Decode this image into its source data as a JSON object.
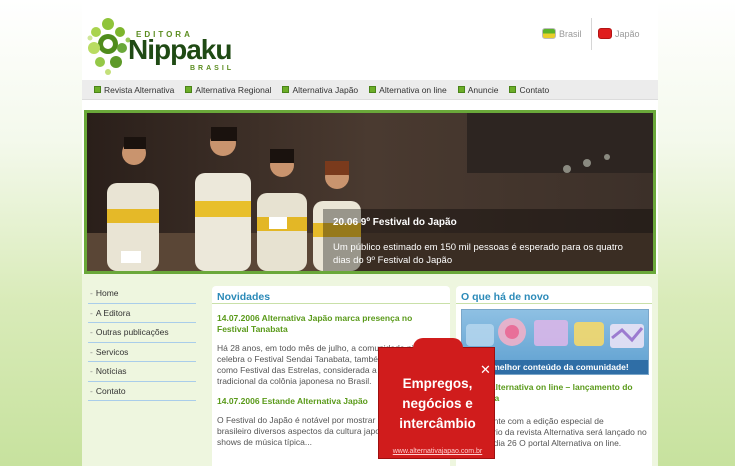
{
  "header": {
    "logo_small_top": "EDITORA",
    "logo_name": "Nippaku",
    "logo_small_bottom": "BRASIL",
    "languages": [
      {
        "label": "Brasil",
        "icon": "brazil-flag-icon"
      },
      {
        "label": "Japão",
        "icon": "japan-flag-icon"
      }
    ]
  },
  "nav": {
    "items": [
      {
        "label": "Revista Alternativa"
      },
      {
        "label": "Alternativa Regional"
      },
      {
        "label": "Alternativa Japão"
      },
      {
        "label": "Alternativa on line"
      },
      {
        "label": "Anuncie"
      },
      {
        "label": "Contato"
      }
    ]
  },
  "banner": {
    "title": "20.06 9º Festival do Japão",
    "text": "Um público estimado em 150 mil pessoas é esperado para os quatro dias do 9º Festival do Japão"
  },
  "sidebar": {
    "items": [
      {
        "label": "Home"
      },
      {
        "label": "A Editora"
      },
      {
        "label": "Outras publicações"
      },
      {
        "label": "Servicos"
      },
      {
        "label": "Notícias"
      },
      {
        "label": "Contato"
      }
    ]
  },
  "news": {
    "title": "Novidades",
    "items": [
      {
        "headline": "14.07.2006 Alternativa Japão marca presença no Festival Tanabata",
        "body": "Há 28 anos, em todo mês de julho, a comunidade nikkei celebra o Festival Sendai Tanabata, também conhecido como Festival das Estrelas, considerada a maior festividade tradicional da colônia japonesa no Brasil."
      },
      {
        "headline": "14.07.2006 Estande Alternativa Japão",
        "body": "O Festival do Japão é notável por mostrar ao público brasileiro diversos aspectos da cultura japonesa, com shows de música típica..."
      }
    ]
  },
  "whats_new": {
    "title": "O que há de novo",
    "promo_caption": "O melhor conteúdo da comunidade!",
    "headline": "25.05 - Alternativa on line – lançamento do portal dia",
    "body": "Juntamente com a edição especial de aniversário da revista Alternativa será lançado no próximo dia 26 O portal Alternativa on line."
  },
  "popup": {
    "text": "Empregos, negócios e intercâmbio",
    "url": "www.alternativajapao.com.br",
    "close": "✕"
  },
  "colors": {
    "brand_green": "#6aa83a",
    "link_blue": "#2b8ab8",
    "headline_green": "#5a9a1a",
    "popup_red": "#d01c1c"
  }
}
